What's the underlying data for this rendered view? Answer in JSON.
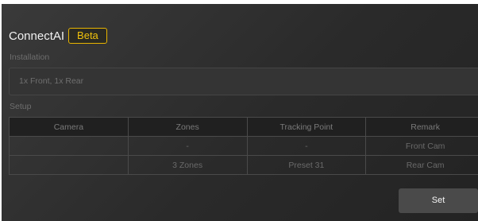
{
  "header": {
    "title": "ConnectAI",
    "badge": "Beta"
  },
  "installation": {
    "label": "Installation",
    "value": "1x Front, 1x Rear"
  },
  "setup": {
    "label": "Setup",
    "columns": [
      "Camera",
      "Zones",
      "Tracking Point",
      "Remark"
    ],
    "rows": [
      [
        "",
        "-",
        "-",
        "Front Cam"
      ],
      [
        "",
        "3 Zones",
        "Preset 31",
        "Rear Cam"
      ]
    ]
  },
  "actions": {
    "set_label": "Set"
  },
  "colors": {
    "accent": "#e8b400",
    "panel_bg": "#2e2e2e",
    "header_bg": "#202020"
  }
}
